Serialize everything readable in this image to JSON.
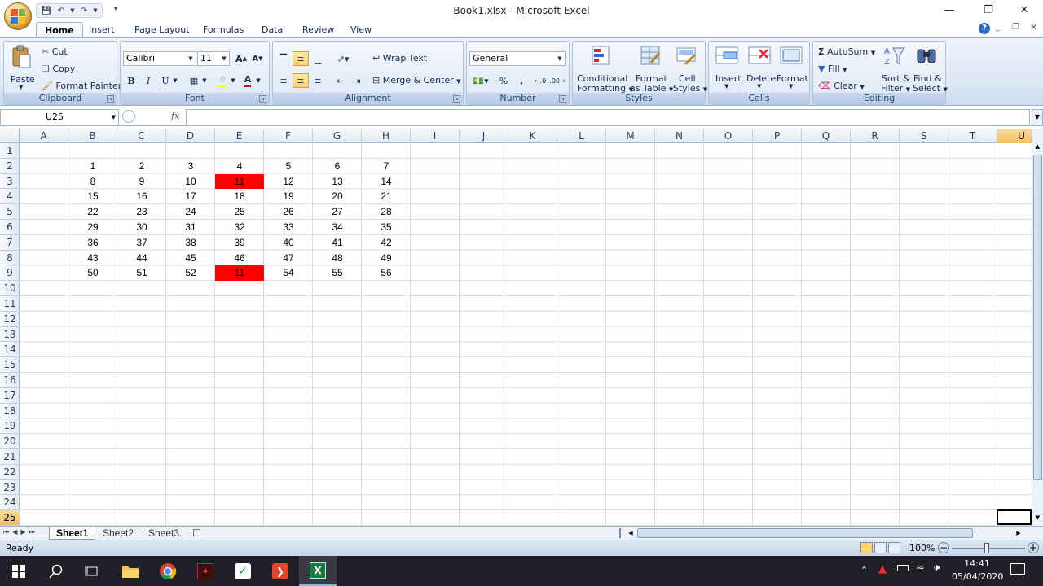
{
  "window": {
    "title": "Book1.xlsx  -  Microsoft Excel"
  },
  "tabs": [
    "Home",
    "Insert",
    "Page Layout",
    "Formulas",
    "Data",
    "Review",
    "View"
  ],
  "clipboard": {
    "paste": "Paste",
    "cut": "Cut",
    "copy": "Copy",
    "format_painter": "Format Painter",
    "label": "Clipboard"
  },
  "font": {
    "name": "Calibri",
    "size": "11",
    "label": "Font",
    "bold": "B",
    "italic": "I",
    "underline": "U"
  },
  "alignment": {
    "wrap": "Wrap Text",
    "merge": "Merge & Center",
    "label": "Alignment"
  },
  "number": {
    "format": "General",
    "percent": "%",
    "comma": ",",
    "label": "Number"
  },
  "styles": {
    "conditional": "Conditional",
    "conditional2": "Formatting",
    "format_as": "Format",
    "format_as2": "as Table",
    "cell": "Cell",
    "cell2": "Styles",
    "label": "Styles"
  },
  "cells_group": {
    "insert": "Insert",
    "delete": "Delete",
    "format": "Format",
    "label": "Cells"
  },
  "editing": {
    "autosum": "AutoSum",
    "fill": "Fill",
    "clear": "Clear",
    "sort": "Sort &",
    "sort2": "Filter",
    "find": "Find &",
    "find2": "Select",
    "label": "Editing"
  },
  "formula_bar": {
    "name_box": "U25",
    "fx": "fx",
    "value": ""
  },
  "columns": [
    "A",
    "B",
    "C",
    "D",
    "E",
    "F",
    "G",
    "H",
    "I",
    "J",
    "K",
    "L",
    "M",
    "N",
    "O",
    "P",
    "Q",
    "R",
    "S",
    "T",
    "U"
  ],
  "rows": [
    "1",
    "2",
    "3",
    "4",
    "5",
    "6",
    "7",
    "8",
    "9",
    "10",
    "11",
    "12",
    "13",
    "14",
    "15",
    "16",
    "17",
    "18",
    "19",
    "20",
    "21",
    "22",
    "23",
    "24",
    "25"
  ],
  "grid": [
    {
      "row": 2,
      "values": [
        "1",
        "2",
        "3",
        "4",
        "5",
        "6",
        "7"
      ]
    },
    {
      "row": 3,
      "values": [
        "8",
        "9",
        "10",
        "11",
        "12",
        "13",
        "14"
      ]
    },
    {
      "row": 4,
      "values": [
        "15",
        "16",
        "17",
        "18",
        "19",
        "20",
        "21"
      ]
    },
    {
      "row": 5,
      "values": [
        "22",
        "23",
        "24",
        "25",
        "26",
        "27",
        "28"
      ]
    },
    {
      "row": 6,
      "values": [
        "29",
        "30",
        "31",
        "32",
        "33",
        "34",
        "35"
      ]
    },
    {
      "row": 7,
      "values": [
        "36",
        "37",
        "38",
        "39",
        "40",
        "41",
        "42"
      ]
    },
    {
      "row": 8,
      "values": [
        "43",
        "44",
        "45",
        "46",
        "47",
        "48",
        "49"
      ]
    },
    {
      "row": 9,
      "values": [
        "50",
        "51",
        "52",
        "11",
        "54",
        "55",
        "56"
      ]
    }
  ],
  "highlighted_cells": [
    "E3",
    "E9"
  ],
  "highlight_color": "#ff0000",
  "sheets": [
    "Sheet1",
    "Sheet2",
    "Sheet3"
  ],
  "status": {
    "text": "Ready",
    "zoom": "100%"
  },
  "clock": {
    "time": "14:41",
    "date": "05/04/2020"
  }
}
